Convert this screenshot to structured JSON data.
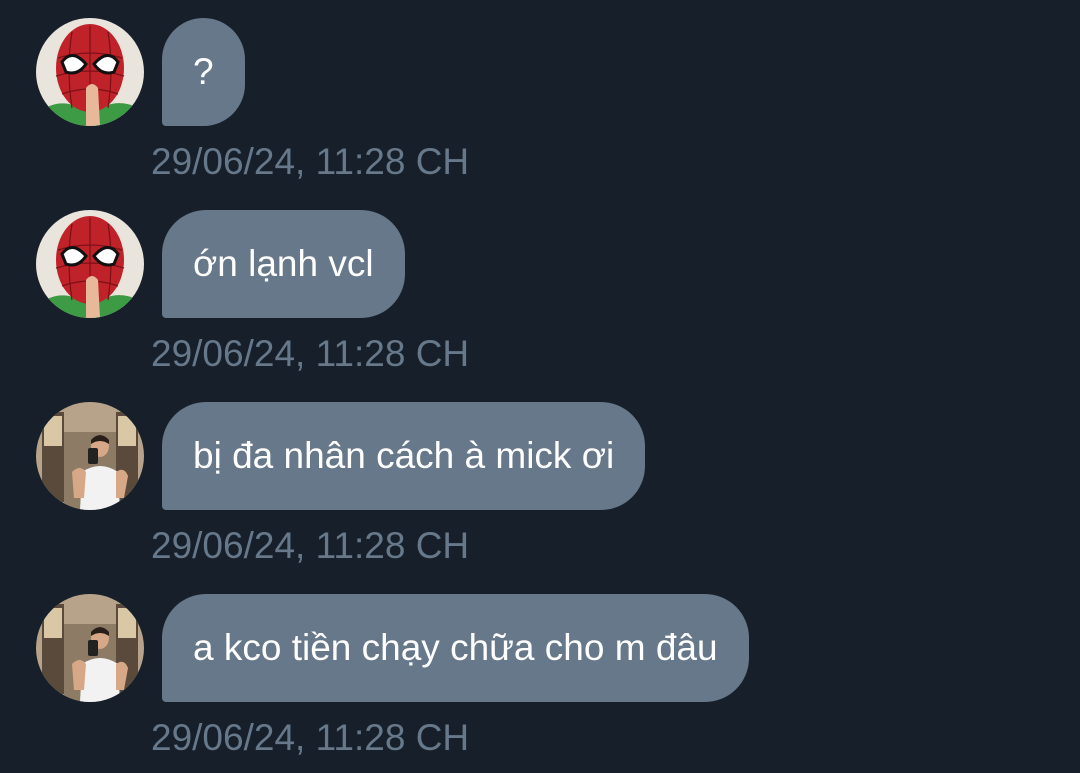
{
  "colors": {
    "background": "#17202a",
    "bubble": "#66788a",
    "bubble_text": "#ffffff",
    "timestamp": "#66788a"
  },
  "messages": [
    {
      "sender_avatar": "spiderman-mask-avatar",
      "text": "?",
      "time": "29/06/24, 11:28 CH"
    },
    {
      "sender_avatar": "spiderman-mask-avatar",
      "text": "ớn lạnh vcl",
      "time": "29/06/24, 11:28 CH"
    },
    {
      "sender_avatar": "mirror-selfie-avatar",
      "text": "bị đa nhân cách à mick ơi",
      "time": "29/06/24, 11:28 CH"
    },
    {
      "sender_avatar": "mirror-selfie-avatar",
      "text": "a kco tiền chạy chữa cho m đâu",
      "time": "29/06/24, 11:28 CH"
    }
  ]
}
